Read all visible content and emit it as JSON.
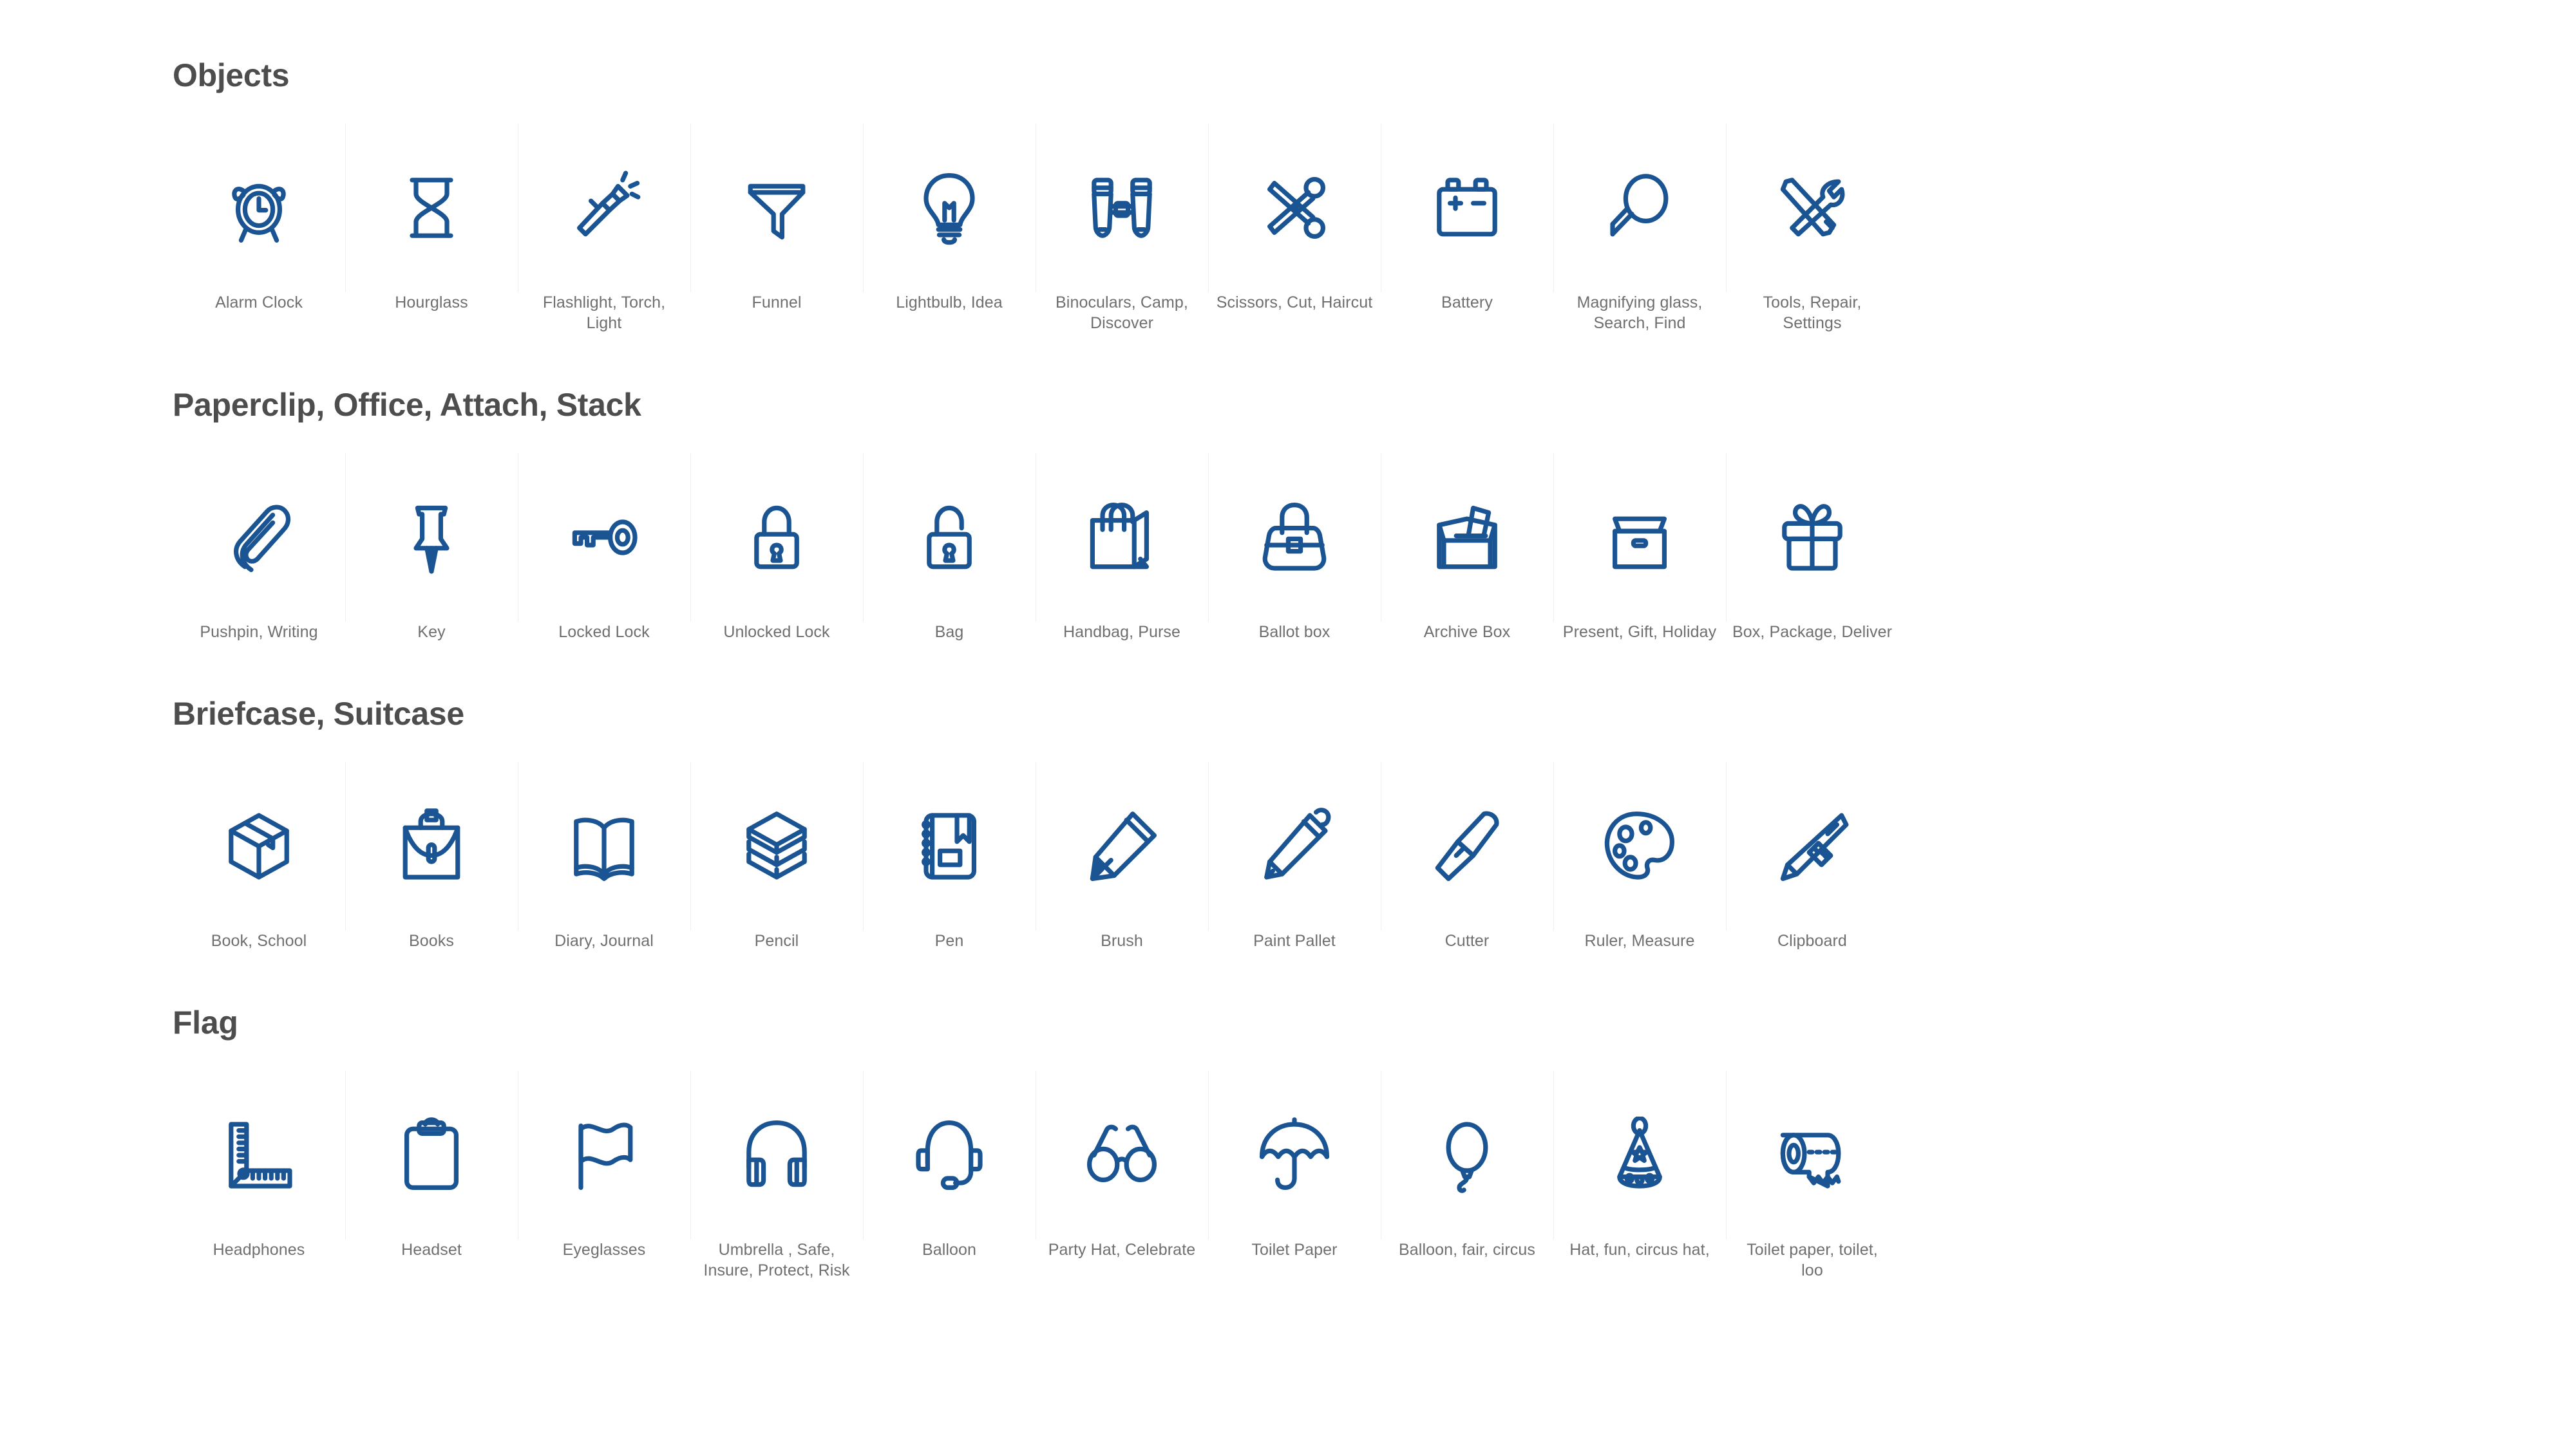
{
  "page": {
    "background_color": "#ffffff",
    "icon_color": "#1a5493",
    "heading_color": "#4d4d4d",
    "label_color": "#6f6f6f",
    "divider_color": "#efefef"
  },
  "sections": [
    {
      "title": "Objects",
      "items": [
        {
          "label": "Alarm Clock",
          "icon": "alarm-clock-icon"
        },
        {
          "label": "Hourglass",
          "icon": "hourglass-icon"
        },
        {
          "label": "Flashlight, Torch,\nLight",
          "icon": "flashlight-icon"
        },
        {
          "label": "Funnel",
          "icon": "funnel-icon"
        },
        {
          "label": "Lightbulb,  Idea",
          "icon": "lightbulb-icon"
        },
        {
          "label": "Binoculars, Camp,\nDiscover",
          "icon": "binoculars-icon"
        },
        {
          "label": "Scissors, Cut, Haircut",
          "icon": "scissors-icon"
        },
        {
          "label": "Battery",
          "icon": "battery-icon"
        },
        {
          "label": "Magnifying glass,\nSearch, Find",
          "icon": "magnifying-glass-icon"
        },
        {
          "label": "Tools, Repair,\nSettings",
          "icon": "tools-icon"
        }
      ]
    },
    {
      "title": "Paperclip, Office, Attach, Stack",
      "items": [
        {
          "label": "Pushpin, Writing",
          "icon": "paperclip-icon"
        },
        {
          "label": "Key",
          "icon": "pushpin-icon"
        },
        {
          "label": "Locked Lock",
          "icon": "key-icon"
        },
        {
          "label": "Unlocked Lock",
          "icon": "locked-lock-icon"
        },
        {
          "label": "Bag",
          "icon": "unlocked-lock-icon"
        },
        {
          "label": "Handbag,  Purse",
          "icon": "shopping-bag-icon"
        },
        {
          "label": "Ballot box",
          "icon": "handbag-icon"
        },
        {
          "label": "Archive Box",
          "icon": "ballot-box-icon"
        },
        {
          "label": "Present, Gift, Holiday",
          "icon": "archive-box-icon"
        },
        {
          "label": "Box, Package, Deliver",
          "icon": "gift-icon"
        }
      ]
    },
    {
      "title": "Briefcase, Suitcase",
      "items": [
        {
          "label": "Book, School",
          "icon": "package-box-icon"
        },
        {
          "label": "Books",
          "icon": "briefcase-icon"
        },
        {
          "label": "Diary, Journal",
          "icon": "open-book-icon"
        },
        {
          "label": "Pencil",
          "icon": "books-stack-icon"
        },
        {
          "label": "Pen",
          "icon": "notebook-icon"
        },
        {
          "label": "Brush",
          "icon": "pencil-icon"
        },
        {
          "label": "Paint Pallet",
          "icon": "pen-icon"
        },
        {
          "label": "Cutter",
          "icon": "paintbrush-icon"
        },
        {
          "label": "Ruler, Measure",
          "icon": "paint-palette-icon"
        },
        {
          "label": "Clipboard",
          "icon": "cutter-knife-icon"
        }
      ]
    },
    {
      "title": "Flag",
      "items": [
        {
          "label": "Headphones",
          "icon": "ruler-icon"
        },
        {
          "label": "Headset",
          "icon": "clipboard-icon"
        },
        {
          "label": "Eyeglasses",
          "icon": "flag-icon"
        },
        {
          "label": "Umbrella , Safe,\nInsure, Protect, Risk",
          "icon": "headphones-icon"
        },
        {
          "label": "Balloon",
          "icon": "headset-icon"
        },
        {
          "label": "Party Hat, Celebrate",
          "icon": "eyeglasses-icon"
        },
        {
          "label": "Toilet Paper",
          "icon": "umbrella-icon"
        },
        {
          "label": "Balloon, fair, circus",
          "icon": "balloon-icon"
        },
        {
          "label": "Hat, fun, circus hat,",
          "icon": "party-hat-icon"
        },
        {
          "label": "Toilet paper, toilet,\nloo",
          "icon": "toilet-paper-icon"
        }
      ]
    }
  ]
}
